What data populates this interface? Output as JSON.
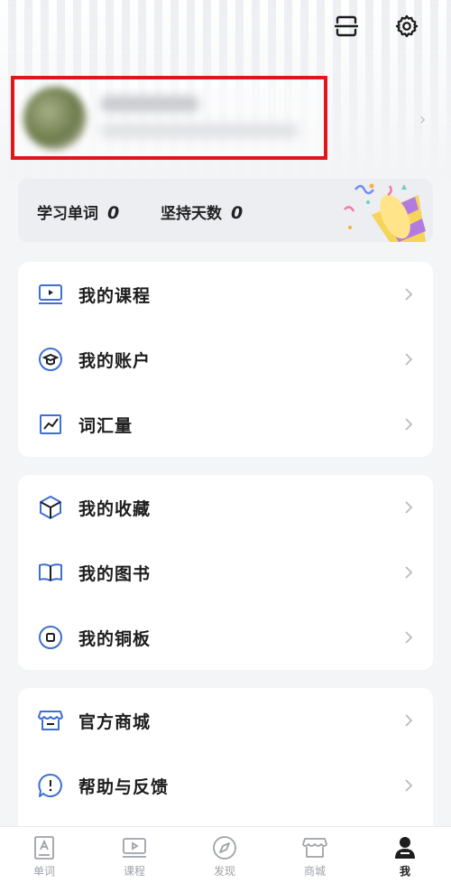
{
  "profile": {
    "chevron": "›"
  },
  "stats": {
    "words_label": "学习单词",
    "words_value": "0",
    "days_label": "坚持天数",
    "days_value": "0"
  },
  "menu_group_1": [
    {
      "label": "我的课程",
      "icon": "video-lesson-icon"
    },
    {
      "label": "我的账户",
      "icon": "graduation-cap-icon"
    },
    {
      "label": "词汇量",
      "icon": "line-chart-icon"
    }
  ],
  "menu_group_2": [
    {
      "label": "我的收藏",
      "icon": "cube-icon"
    },
    {
      "label": "我的图书",
      "icon": "book-icon"
    },
    {
      "label": "我的铜板",
      "icon": "coin-icon"
    }
  ],
  "menu_group_3": [
    {
      "label": "官方商城",
      "icon": "store-icon"
    },
    {
      "label": "帮助与反馈",
      "icon": "help-chat-icon"
    }
  ],
  "tabbar": [
    {
      "label": "单词",
      "icon": "word-card-icon"
    },
    {
      "label": "课程",
      "icon": "video-lesson-icon"
    },
    {
      "label": "发现",
      "icon": "compass-icon"
    },
    {
      "label": "商城",
      "icon": "store-icon"
    },
    {
      "label": "我",
      "icon": "user-icon",
      "active": true
    }
  ],
  "colors": {
    "accent": "#3f6fd1",
    "highlight_border": "#e0161b",
    "background": "#f4f5f7"
  }
}
